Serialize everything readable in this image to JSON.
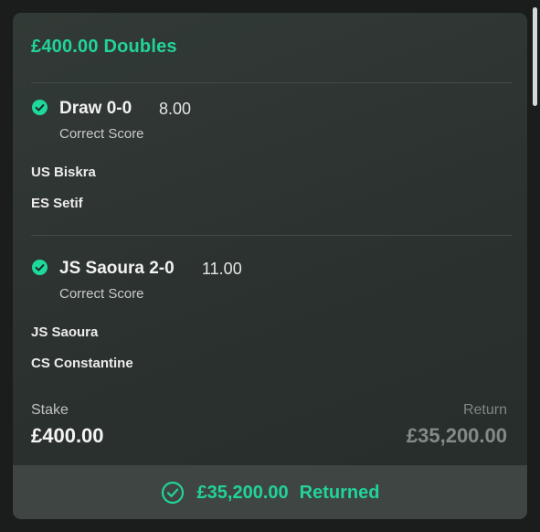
{
  "bet": {
    "title": "£400.00 Doubles",
    "selections": [
      {
        "name": "Draw 0-0",
        "odds": "8.00",
        "market": "Correct Score",
        "teams": [
          "US Biskra",
          "ES Setif"
        ],
        "status_icon": "check-circle-icon"
      },
      {
        "name": "JS Saoura 2-0",
        "odds": "11.00",
        "market": "Correct Score",
        "teams": [
          "JS Saoura",
          "CS Constantine"
        ],
        "status_icon": "check-circle-icon"
      }
    ],
    "stake": {
      "label": "Stake",
      "value": "£400.00"
    },
    "return": {
      "label": "Return",
      "value": "£35,200.00"
    }
  },
  "footer": {
    "amount": "£35,200.00",
    "status": "Returned",
    "icon": "check-circle-outline-icon"
  },
  "colors": {
    "accent": "#22d39a",
    "card_background": "#2e3532",
    "footer_background": "#3e4543"
  }
}
